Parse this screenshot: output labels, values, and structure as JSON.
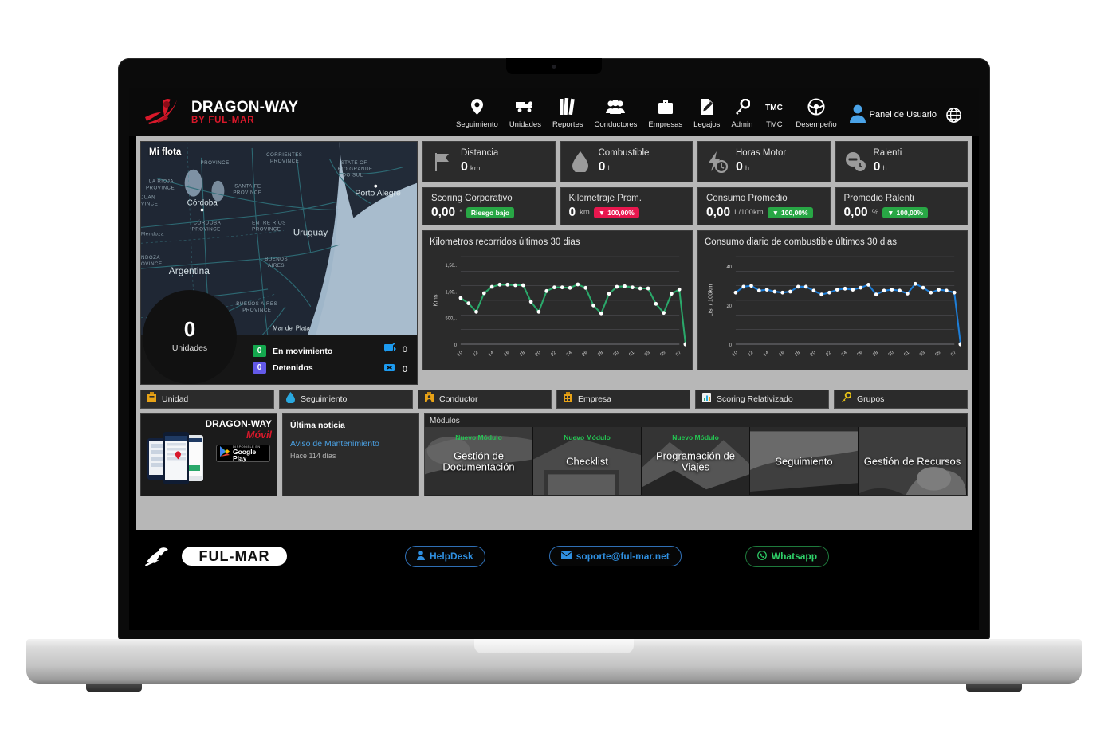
{
  "brand": {
    "title": "DRAGON-WAY",
    "subtitle": "BY FUL-MAR"
  },
  "nav": {
    "items": [
      {
        "label": "Seguimiento",
        "icon": "map-pin-icon"
      },
      {
        "label": "Unidades",
        "icon": "truck-icon"
      },
      {
        "label": "Reportes",
        "icon": "books-icon"
      },
      {
        "label": "Conductores",
        "icon": "people-icon"
      },
      {
        "label": "Empresas",
        "icon": "briefcase-icon"
      },
      {
        "label": "Legajos",
        "icon": "document-pen-icon"
      },
      {
        "label": "Admin",
        "icon": "key-icon"
      },
      {
        "label": "TMC",
        "icon": "tmc-text-icon"
      },
      {
        "label": "Desempeño",
        "icon": "steering-wheel-icon"
      }
    ],
    "user_panel": "Panel de Usuario",
    "user_icon": "user-avatar-icon",
    "language_icon": "globe-icon"
  },
  "map": {
    "title": "Mi flota",
    "units_count": "0",
    "units_label": "Unidades",
    "legend": [
      {
        "count": "0",
        "label": "En movimiento",
        "color": "#14a84e"
      },
      {
        "count": "0",
        "label": "Detenidos",
        "color": "#6359e8"
      }
    ],
    "counters": [
      {
        "icon": "no-signal-icon",
        "value": "0"
      },
      {
        "icon": "no-vehicle-icon",
        "value": "0"
      }
    ],
    "place_labels": [
      "LA RIOJA PROVINCE",
      "SAN JUAN PROVINCE",
      "SANTA FE PROVINCE",
      "CORRIENTES PROVINCE",
      "STATE OF RIO GRANDE DO SUL",
      "Porto Alegre",
      "Córdoba",
      "CÓRDOBA PROVINCE",
      "ENTRE RÍOS PROVINCE",
      "Uruguay",
      "Mendoza",
      "MENDOZA PROVINCE",
      "Argentina",
      "BUENOS AIRES",
      "BUENOS AIRES PROVINCE",
      "Mar del Plata"
    ]
  },
  "kpis": [
    {
      "title": "Distancia",
      "value": "0",
      "unit": "km",
      "icon": "flag-icon"
    },
    {
      "title": "Combustible",
      "value": "0",
      "unit": "L",
      "icon": "fuel-drop-icon"
    },
    {
      "title": "Horas Motor",
      "value": "0",
      "unit": "h.",
      "icon": "engine-hours-icon"
    },
    {
      "title": "Ralenti",
      "value": "0",
      "unit": "h.",
      "icon": "idle-clock-icon"
    }
  ],
  "kpis2": [
    {
      "title": "Scoring Corporativo",
      "value": "0,00",
      "unit": "",
      "pill": "Riesgo bajo",
      "pill_color": "green",
      "pill_arrow": ""
    },
    {
      "title": "Kilometraje Prom.",
      "value": "0",
      "unit": "km",
      "pill": "100,00%",
      "pill_color": "red",
      "pill_arrow": "▼"
    },
    {
      "title": "Consumo Promedio",
      "value": "0,00",
      "unit": "L/100km",
      "pill": "100,00%",
      "pill_color": "green",
      "pill_arrow": "▼"
    },
    {
      "title": "Promedio Ralenti",
      "value": "0,00",
      "unit": "%",
      "pill": "100,00%",
      "pill_color": "green",
      "pill_arrow": "▼"
    }
  ],
  "chart_data": [
    {
      "type": "line",
      "title": "Kilometros recorridos últimos 30 dias",
      "xlabel": "",
      "ylabel": "Kms",
      "ylim": [
        0,
        1650
      ],
      "yticks": [
        0,
        500,
        1000,
        1500
      ],
      "ytick_labels": [
        "0",
        "500,..",
        "1,00..",
        "1,50.."
      ],
      "grid": true,
      "color": "#2aa86a",
      "x": [
        "10",
        "11",
        "12",
        "13",
        "14",
        "15",
        "16",
        "17",
        "18",
        "19",
        "20",
        "21",
        "22",
        "23",
        "24",
        "25",
        "26",
        "27",
        "28",
        "29",
        "30",
        "01",
        "02",
        "03",
        "04",
        "05",
        "06",
        "07",
        "08"
      ],
      "xtick_labels": [
        "10",
        "12",
        "14",
        "16",
        "18",
        "20",
        "22",
        "24",
        "26",
        "28",
        "30",
        "01",
        "03",
        "05",
        "07"
      ],
      "values": [
        870,
        770,
        610,
        960,
        1080,
        1120,
        1120,
        1110,
        1110,
        800,
        610,
        1000,
        1070,
        1070,
        1060,
        1125,
        1060,
        730,
        580,
        950,
        1080,
        1090,
        1070,
        1050,
        1050,
        760,
        590,
        950,
        1030
      ]
    },
    {
      "type": "line",
      "title": "Consumo diario de combustible últimos 30 dias",
      "xlabel": "",
      "ylabel": "Lts. / 100km",
      "ylim": [
        0,
        45
      ],
      "yticks": [
        0,
        20,
        40
      ],
      "ytick_labels": [
        "0",
        "20",
        "40"
      ],
      "grid": true,
      "color": "#1d7ed8",
      "x": [
        "10",
        "11",
        "12",
        "13",
        "14",
        "15",
        "16",
        "17",
        "18",
        "19",
        "20",
        "21",
        "22",
        "23",
        "24",
        "25",
        "26",
        "27",
        "28",
        "29",
        "30",
        "01",
        "02",
        "03",
        "04",
        "05",
        "06",
        "07",
        "08"
      ],
      "xtick_labels": [
        "10",
        "12",
        "14",
        "16",
        "18",
        "20",
        "22",
        "24",
        "26",
        "28",
        "30",
        "01",
        "03",
        "05",
        "07"
      ],
      "values": [
        26.5,
        29.5,
        30,
        27.5,
        28,
        27,
        26.5,
        27,
        29.5,
        29.5,
        27.5,
        25.5,
        26.5,
        28,
        28.5,
        28,
        29,
        30.5,
        25.5,
        27.5,
        28,
        27.5,
        26,
        31,
        29,
        26.5,
        28,
        27.5,
        26.5
      ]
    }
  ],
  "tabs": [
    {
      "label": "Unidad",
      "icon": "unit-icon"
    },
    {
      "label": "Seguimiento",
      "icon": "tracking-drop-icon"
    },
    {
      "label": "Conductor",
      "icon": "driver-icon"
    },
    {
      "label": "Empresa",
      "icon": "company-icon"
    },
    {
      "label": "Scoring Relativizado",
      "icon": "bar-chart-icon"
    },
    {
      "label": "Grupos",
      "icon": "key-icon"
    }
  ],
  "promo": {
    "title": "DRAGON-WAY",
    "subtitle": "Móvil",
    "store_small": "DISPONIBLE EN",
    "store_big": "Google Play",
    "store_icon": "google-play-icon",
    "phones_icon": "phone-screens-image"
  },
  "news": {
    "heading": "Última noticia",
    "link": "Aviso de Mantenimiento",
    "time": "Hace 114 días"
  },
  "modules": {
    "label": "Módulos",
    "new_badge": "Nuevo Módulo",
    "tiles": [
      {
        "name": "Gestión de Documentación",
        "is_new": true
      },
      {
        "name": "Checklist",
        "is_new": true
      },
      {
        "name": "Programación de Viajes",
        "is_new": true
      },
      {
        "name": "Seguimiento",
        "is_new": false
      },
      {
        "name": "Gestión de Recursos",
        "is_new": false
      }
    ]
  },
  "footer": {
    "logo_text": "FUL-MAR",
    "buttons": [
      {
        "label": "HelpDesk",
        "icon": "person-icon",
        "style": "blue"
      },
      {
        "label": "soporte@ful-mar.net",
        "icon": "envelope-icon",
        "style": "blue"
      },
      {
        "label": "Whatsapp",
        "icon": "whatsapp-icon",
        "style": "green"
      }
    ]
  },
  "colors": {
    "brand_red": "#d8182a",
    "accent_green": "#28a745",
    "accent_red": "#e8174e",
    "link_blue": "#4a9fe0",
    "chart_green": "#2aa86a",
    "chart_blue": "#1d7ed8"
  }
}
